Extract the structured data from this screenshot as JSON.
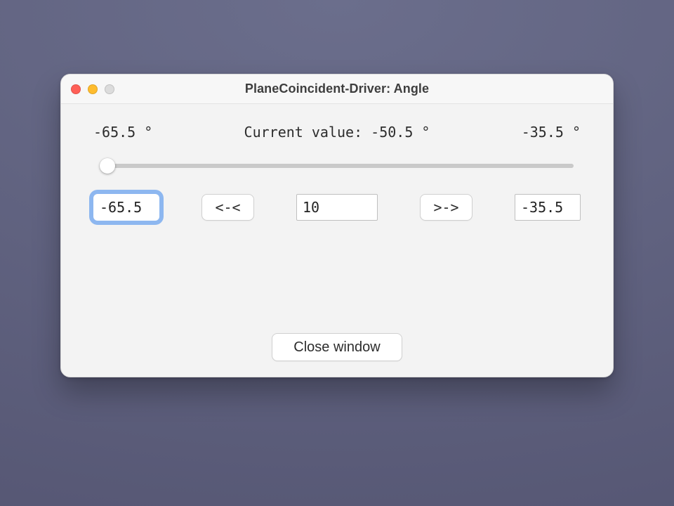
{
  "window": {
    "title": "PlaneCoincident-Driver: Angle"
  },
  "range": {
    "min_label": "-65.5 °",
    "max_label": "-35.5 °",
    "current_label": "Current value: -50.5 °"
  },
  "slider": {
    "min": -65.5,
    "max": -35.5,
    "value": -65.5,
    "thumb_left_css": "20px"
  },
  "inputs": {
    "min_value": "-65.5",
    "step_value": "10",
    "max_value": "-35.5"
  },
  "buttons": {
    "step_back_label": "<-<",
    "step_fwd_label": ">->",
    "close_label": "Close window"
  }
}
